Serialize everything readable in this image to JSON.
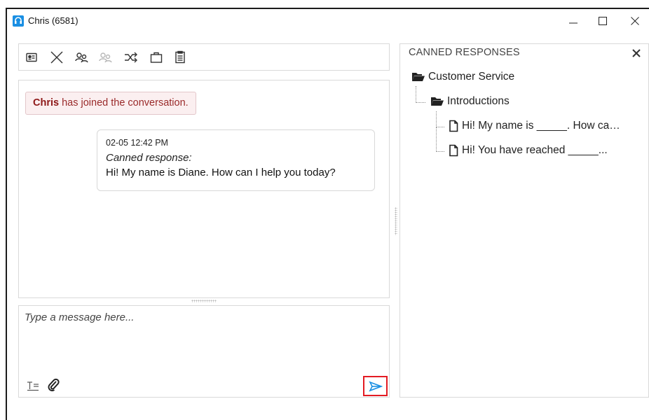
{
  "window": {
    "title": "Chris (6581)"
  },
  "toolbar": {
    "icons": [
      "contact-card-icon",
      "end-chat-icon",
      "conference-icon",
      "conference-disabled-icon",
      "transfer-icon",
      "briefcase-icon",
      "transcript-icon"
    ]
  },
  "conversation": {
    "system_name": "Chris",
    "system_text": " has joined the conversation.",
    "message": {
      "timestamp": "02-05 12:42 PM",
      "kind": "Canned response:",
      "body": "Hi! My name is Diane. How can I help you today?"
    }
  },
  "compose": {
    "placeholder": "Type a message here..."
  },
  "canned": {
    "title": "CANNED RESPONSES",
    "tree": {
      "folder": "Customer Service",
      "subfolder": "Introductions",
      "items": [
        "Hi! My name is _____. How ca…",
        "Hi! You have reached _____..."
      ]
    }
  },
  "colors": {
    "accent": "#1a8fe3",
    "send_highlight": "#e31b23",
    "system_text": "#9a2a2a"
  }
}
